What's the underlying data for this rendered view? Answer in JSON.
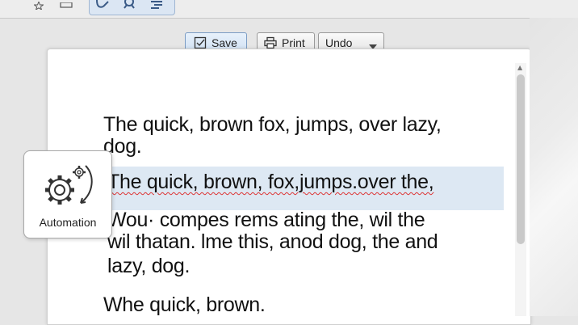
{
  "toolbar": {
    "save_label": "Save",
    "print_label": "Print",
    "undo_label": "Undo"
  },
  "document": {
    "lines": [
      "The quick, brown fox, jumps, over lazy,",
      "dog.",
      "The quick, brown, fox,jumps.over the,",
      "Wou· compes rems ating the, wil the",
      "wil thatan. lme this, anod dog, the and",
      "lazy, dog.",
      "Whe quick, brown."
    ]
  },
  "automation": {
    "label": "Automation"
  },
  "icons": {
    "top_left_1": "star-icon",
    "top_left_2": "window-icon",
    "group_1": "link-icon",
    "group_2": "search-icon",
    "group_3": "edit-icon",
    "save": "save-icon",
    "print": "printer-icon",
    "undo_dropdown": "chevron-down-icon",
    "automation": "gear-icon"
  },
  "colors": {
    "highlight": "#dde8f3",
    "accent": "#7b9cc4",
    "spell_error": "#d33333"
  }
}
